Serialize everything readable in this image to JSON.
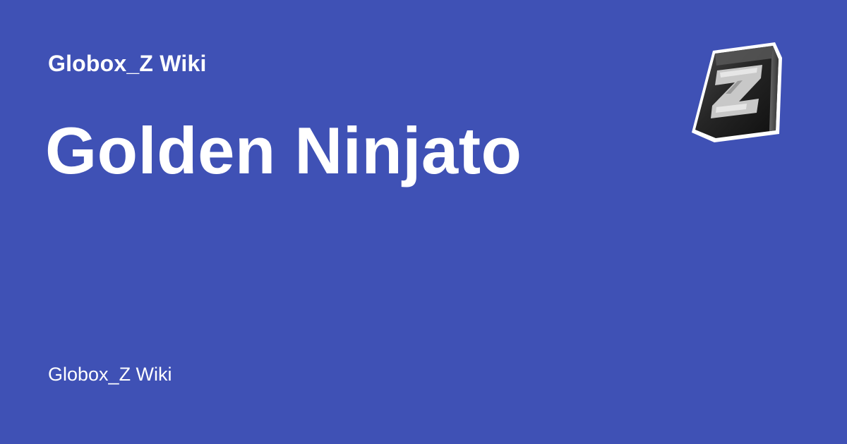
{
  "card": {
    "site_name": "Globox_Z Wiki",
    "page_title": "Golden Ninjato",
    "footer_site_name": "Globox_Z Wiki",
    "logo_icon": "z-block-logo-icon",
    "logo_letter": "Z"
  },
  "colors": {
    "background": "#3f51b5",
    "text": "#ffffff",
    "logo_face": "#222222",
    "logo_outline": "#ffffff",
    "logo_letter": "#c8c8c8"
  }
}
